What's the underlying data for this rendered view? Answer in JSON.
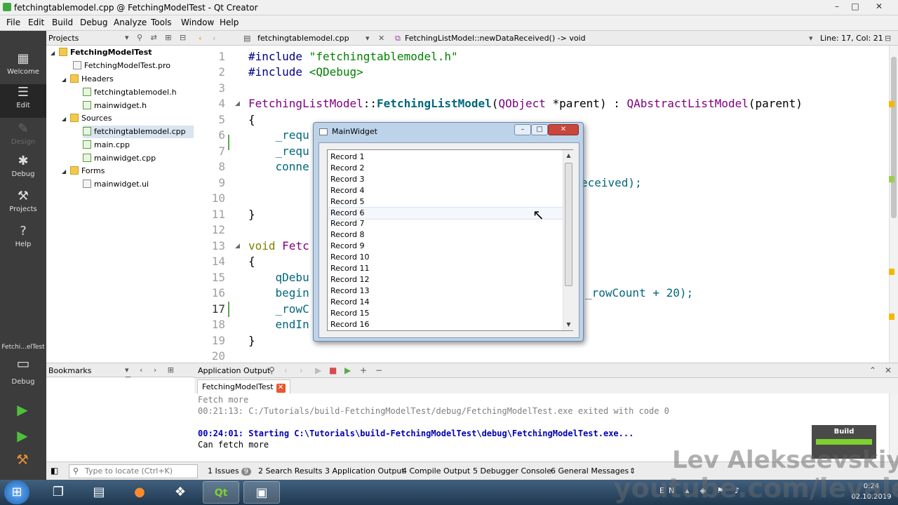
{
  "window": {
    "title": "fetchingtablemodel.cpp @ FetchingModelTest - Qt Creator",
    "min": "–",
    "max": "□",
    "close": "✕"
  },
  "menu": [
    "File",
    "Edit",
    "Build",
    "Debug",
    "Analyze",
    "Tools",
    "Window",
    "Help"
  ],
  "modes": [
    {
      "label": "Welcome",
      "icon": "▦"
    },
    {
      "label": "Edit",
      "icon": "☰"
    },
    {
      "label": "Design",
      "icon": "✎"
    },
    {
      "label": "Debug",
      "icon": "✱"
    },
    {
      "label": "Projects",
      "icon": "⚒"
    },
    {
      "label": "Help",
      "icon": "?"
    }
  ],
  "kit": {
    "label": "Fetchi...elTest",
    "sub": "Debug",
    "icon": "▭"
  },
  "run": {
    "run": "▶",
    "debug_run": "▶",
    "build": "⚒"
  },
  "projects": {
    "header": "Projects",
    "tree": [
      {
        "label": "FetchingModelTest",
        "bold": true
      },
      {
        "label": "FetchingModelTest.pro"
      },
      {
        "label": "Headers"
      },
      {
        "label": "fetchingtablemodel.h"
      },
      {
        "label": "mainwidget.h"
      },
      {
        "label": "Sources"
      },
      {
        "label": "fetchingtablemodel.cpp"
      },
      {
        "label": "main.cpp"
      },
      {
        "label": "mainwidget.cpp"
      },
      {
        "label": "Forms"
      },
      {
        "label": "mainwidget.ui"
      }
    ]
  },
  "bookmarks": {
    "header": "Bookmarks"
  },
  "editor": {
    "file_tab": "fetchingtablemodel.cpp",
    "symbol": "FetchingListModel::newDataReceived() -> void",
    "position": "Line: 17, Col: 21",
    "current_line": 17,
    "lines": [
      "1",
      "2",
      "3",
      "4",
      "5",
      "6",
      "7",
      "8",
      "9",
      "10",
      "11",
      "12",
      "13",
      "14",
      "15",
      "16",
      "17",
      "18",
      "19",
      "20"
    ]
  },
  "code": {
    "l1_a": "#include ",
    "l1_b": "\"fetchingtablemodel.h\"",
    "l2_a": "#include ",
    "l2_b": "<QDebug>",
    "l4_a": "FetchingListModel",
    "l4_b": "::",
    "l4_c": "FetchingListModel",
    "l4_d": "(",
    "l4_e": "QObject",
    "l4_f": " *parent) : ",
    "l4_g": "QAbstractListModel",
    "l4_h": "(parent)",
    "l5": "{",
    "l6": "    _requ",
    "l7": "    _requ",
    "l8": "    conne",
    "l9": "eceived);",
    "l11": "}",
    "l13_a": "void ",
    "l13_b": "Fetc",
    "l14": "{",
    "l15": "    qDebu",
    "l16_a": "    begin",
    "l16_b": "_rowCount + 20);",
    "l17": "    _rowC",
    "l18": "    endIn",
    "l19": "}"
  },
  "dialog": {
    "title": "MainWidget",
    "min": "–",
    "max": "□",
    "close": "✕",
    "records": [
      "Record 1",
      "Record 2",
      "Record 3",
      "Record 4",
      "Record 5",
      "Record 6",
      "Record 7",
      "Record 8",
      "Record 9",
      "Record 10",
      "Record 11",
      "Record 12",
      "Record 13",
      "Record 14",
      "Record 15",
      "Record 16"
    ],
    "hovered_index": 6,
    "cursor": "↖"
  },
  "output": {
    "header": "Application Output",
    "tab": "FetchingModelTest",
    "tab_close": "✕",
    "lines": [
      {
        "text": "Fetch more",
        "style": "gray"
      },
      {
        "text": "00:21:13: C:/Tutorials/build-FetchingModelTest/debug/FetchingModelTest.exe exited with code 0",
        "style": "gray"
      },
      {
        "text": "",
        "style": "gray"
      },
      {
        "text": "00:24:01: Starting C:\\Tutorials\\build-FetchingModelTest\\debug\\FetchingModelTest.exe...",
        "style": "blue"
      },
      {
        "text": "Can fetch more",
        "style": "plain"
      }
    ]
  },
  "build": {
    "label": "Build"
  },
  "status": {
    "locate_placeholder": "Type to locate (Ctrl+K)",
    "tabs": [
      {
        "label": "1  Issues",
        "badge": "9"
      },
      {
        "label": "2  Search Results"
      },
      {
        "label": "3  Application Output"
      },
      {
        "label": "4  Compile Output"
      },
      {
        "label": "5  Debugger Console"
      },
      {
        "label": "6  General Messages"
      }
    ]
  },
  "taskbar": {
    "clock_time": "0:24",
    "clock_date": "02.10.2019",
    "lang": "EN",
    "apps": [
      "❐",
      "▤",
      "●",
      "❖",
      "Qt",
      "▣"
    ]
  },
  "watermark": {
    "name": "Lev Alekseevskiy",
    "url": "youtube.com/levalex"
  }
}
